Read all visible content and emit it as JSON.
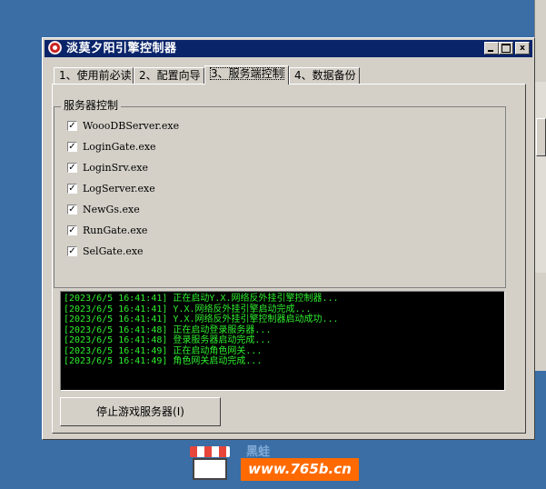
{
  "window": {
    "title": "淡莫夕阳引擎控制器",
    "controls": {
      "minimize": "",
      "maximize": "",
      "close": "x"
    }
  },
  "tabs": [
    {
      "label": "1、使用前必读",
      "active": false
    },
    {
      "label": "2、配置向导",
      "active": false
    },
    {
      "label": "3、服务端控制",
      "active": true
    },
    {
      "label": "4、数据备份",
      "active": false
    }
  ],
  "server_group": {
    "label": "服务器控制",
    "items": [
      {
        "label": "WoooDBServer.exe",
        "checked": true
      },
      {
        "label": "LoginGate.exe",
        "checked": true
      },
      {
        "label": "LoginSrv.exe",
        "checked": true
      },
      {
        "label": "LogServer.exe",
        "checked": true
      },
      {
        "label": "NewGs.exe",
        "checked": true
      },
      {
        "label": "RunGate.exe",
        "checked": true
      },
      {
        "label": "SelGate.exe",
        "checked": true
      }
    ]
  },
  "log": {
    "text_color": "#2ef02e",
    "lines": [
      "[2023/6/5 16:41:41] 正在启动Y.X.网络反外挂引擎控制器...",
      "[2023/6/5 16:41:41] Y.X.网络反外挂引擎启动完成...",
      "[2023/6/5 16:41:41] Y.X.网络反外挂引擎控制器启动成功...",
      "[2023/6/5 16:41:48] 正在启动登录服务器...",
      "[2023/6/5 16:41:48] 登录服务器启动完成...",
      "[2023/6/5 16:41:49] 正在启动角色网关...",
      "[2023/6/5 16:41:49] 角色网关启动完成..."
    ]
  },
  "stop_button": {
    "label": "停止游戏服务器(I)"
  },
  "watermark": {
    "cn_text": "黑蛙",
    "url": "www.765b.cn"
  },
  "colors": {
    "desktop": "#3a6ea5",
    "titlebar": "#0a246a",
    "face": "#d4d0c8",
    "watermark_orange": "#ff6a00"
  }
}
